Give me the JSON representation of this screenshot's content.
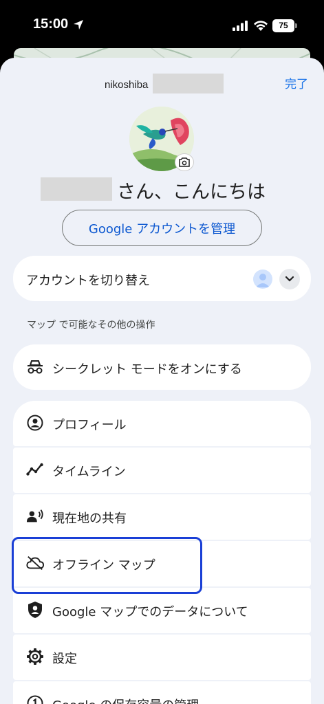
{
  "status": {
    "time": "15:00",
    "battery": "75"
  },
  "header": {
    "username": "nikoshiba",
    "done_label": "完了"
  },
  "profile": {
    "greeting": "さん、こんにちは",
    "manage_label": "Google アカウントを管理"
  },
  "switch_account": {
    "label": "アカウントを切り替え"
  },
  "section": {
    "label": "マップ で可能なその他の操作"
  },
  "incognito": {
    "label": "シークレット モードをオンにする",
    "icon": "incognito-icon"
  },
  "menu": {
    "items": [
      {
        "label": "プロフィール",
        "icon": "account-circle-icon"
      },
      {
        "label": "タイムライン",
        "icon": "timeline-icon"
      },
      {
        "label": "現在地の共有",
        "icon": "location-sharing-icon"
      },
      {
        "label": "オフライン マップ",
        "icon": "cloud-off-icon"
      },
      {
        "label": "Google マップでのデータについて",
        "icon": "shield-user-icon"
      },
      {
        "label": "設定",
        "icon": "gear-icon"
      },
      {
        "label": "Google の保存容量の管理",
        "icon": "storage-one-icon"
      }
    ]
  },
  "colors": {
    "accent": "#1a73e8",
    "highlight": "#1a3fd6",
    "sheet_bg": "#eef1f8"
  }
}
